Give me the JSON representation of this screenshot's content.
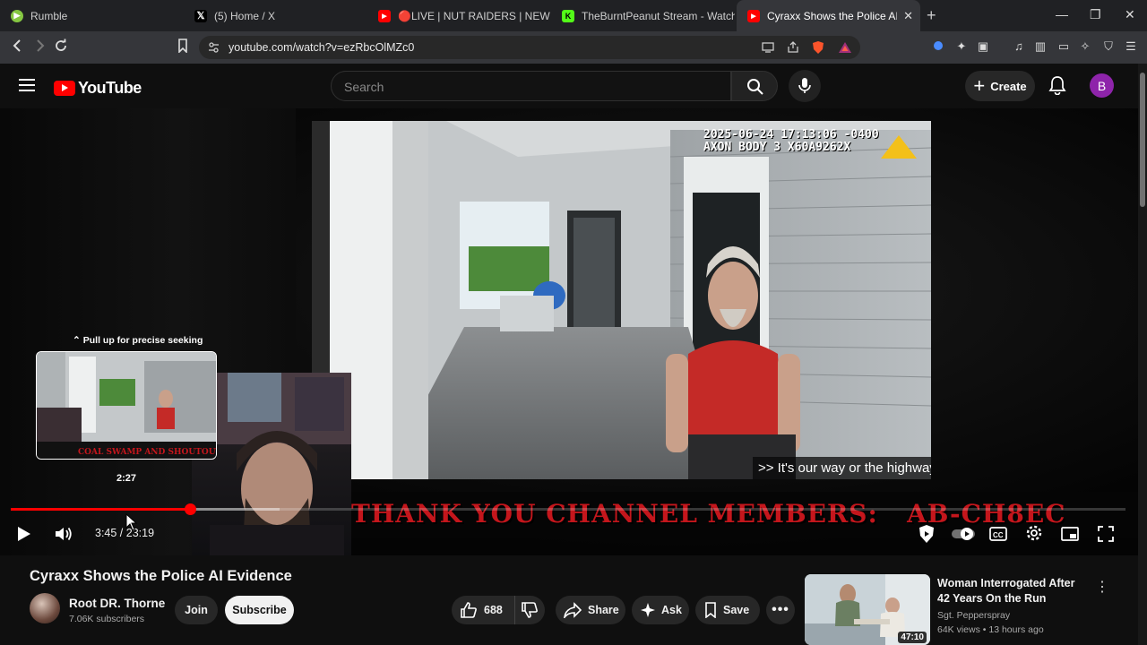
{
  "browser": {
    "tabs": [
      {
        "title": "Rumble",
        "color": "#85c742",
        "glyph": "▶"
      },
      {
        "title": "(5) Home / X",
        "color": "#000000",
        "glyph": "X"
      },
      {
        "title": "🔴LIVE | NUT RAIDERS | NEW YEAR !",
        "color": "#ff0000",
        "glyph": "▶"
      },
      {
        "title": "TheBurntPeanut Stream - Watch Live",
        "color": "#53fc18",
        "glyph": "K"
      },
      {
        "title": "Cyraxx Shows the Police AI Evide",
        "color": "#ff0000",
        "glyph": "▶"
      }
    ],
    "url": "youtube.com/watch?v=ezRbcOlMZc0",
    "window_controls": [
      "minimize-icon",
      "restore-icon",
      "close-icon"
    ]
  },
  "header": {
    "logo_text": "YouTube",
    "search_placeholder": "Search",
    "create_label": "Create",
    "avatar_letter": "B"
  },
  "player": {
    "overlay_timestamp": "2025-06-24 17:13:06 -0400\nAXON BODY 3 X60A9262X",
    "caption_lines": ">> It's our way or the highway.\" Yeah.\n>> She can't She can't go",
    "members_banner": "THANK YOU CHANNEL MEMBERS:   AB-CH8EC",
    "seek_hint": "Pull up for precise seeking",
    "preview_time": "2:27",
    "time_display": "3:45 / 23:19",
    "progress": {
      "played_fraction": 0.161,
      "buffered_fraction": 0.241
    },
    "controls": [
      "play-icon",
      "volume-icon",
      "sponsorblock-icon",
      "autoplay-toggle",
      "captions-icon",
      "settings-icon",
      "miniplayer-icon",
      "fullscreen-icon"
    ]
  },
  "video": {
    "title": "Cyraxx Shows the Police AI Evidence",
    "channel_name": "Root DR. Thorne",
    "subscribers": "7.06K subscribers",
    "join_label": "Join",
    "subscribe_label": "Subscribe",
    "like_count": "688",
    "share_label": "Share",
    "ask_label": "Ask",
    "save_label": "Save"
  },
  "recommendation": {
    "title": "Woman Interrogated After 42 Years On the Run",
    "channel": "Sgt. Pepperspray",
    "meta": "64K views • 13 hours ago",
    "duration": "47:10"
  }
}
